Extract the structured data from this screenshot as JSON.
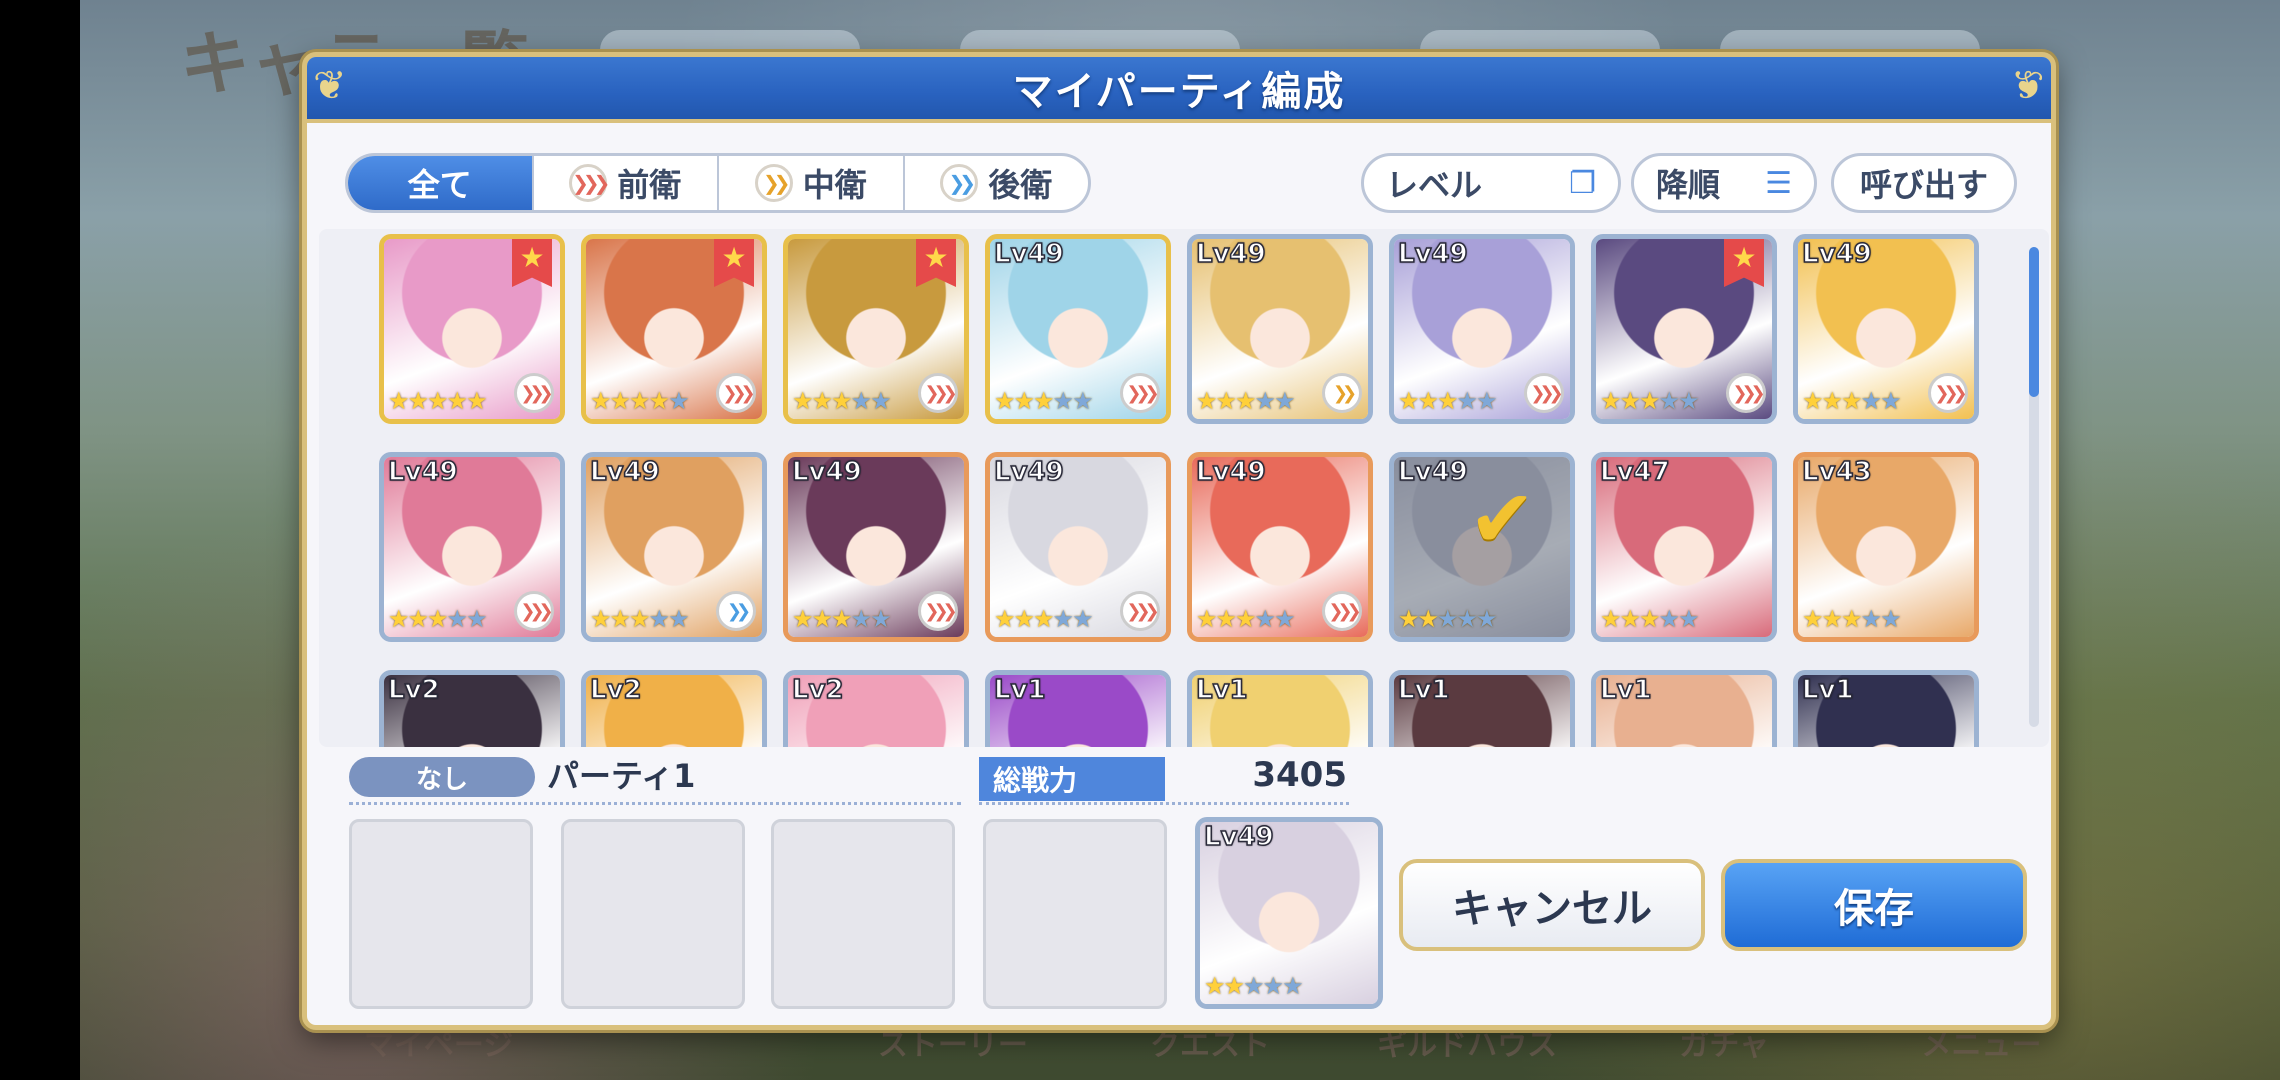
{
  "window": {
    "title": "マイパーティ編成"
  },
  "background": {
    "title": "キャラ一覧",
    "nav": [
      "マイページ",
      "",
      "ストーリー",
      "クエスト",
      "ギルドハウス",
      "ガチャ",
      "メニュー"
    ]
  },
  "filters": {
    "tabs": [
      {
        "label": "全て",
        "active": true
      },
      {
        "label": "前衛",
        "icon": "front-position-icon"
      },
      {
        "label": "中衛",
        "icon": "middle-position-icon"
      },
      {
        "label": "後衛",
        "icon": "back-position-icon"
      }
    ],
    "sort": {
      "label": "レベル",
      "icon": "window-icon"
    },
    "order": {
      "label": "降順",
      "icon": "sort-lines-icon"
    },
    "load": {
      "label": "呼び出す"
    }
  },
  "characters": [
    {
      "level": "",
      "stars": 5,
      "fav": true,
      "role": "front",
      "frame": "gold",
      "color": "#e89ac8"
    },
    {
      "level": "",
      "stars": 4,
      "fav": true,
      "role": "front",
      "frame": "gold",
      "color": "#d9754a"
    },
    {
      "level": "",
      "stars": 3,
      "fav": true,
      "role": "front",
      "frame": "gold",
      "color": "#c89a3e"
    },
    {
      "level": "Lv49",
      "stars": 3,
      "fav": false,
      "role": "front",
      "frame": "gold",
      "color": "#9fd4e8"
    },
    {
      "level": "Lv49",
      "stars": 3,
      "fav": false,
      "role": "middle",
      "frame": "silver",
      "color": "#e6c070"
    },
    {
      "level": "Lv49",
      "stars": 3,
      "fav": false,
      "role": "front",
      "frame": "silver",
      "color": "#a8a0d8"
    },
    {
      "level": "",
      "stars": 3,
      "fav": true,
      "role": "front",
      "frame": "silver",
      "color": "#5a4a80"
    },
    {
      "level": "Lv49",
      "stars": 3,
      "fav": false,
      "role": "front",
      "frame": "silver",
      "color": "#f2c050"
    },
    {
      "level": "Lv49",
      "stars": 3,
      "fav": false,
      "role": "front",
      "frame": "silver",
      "color": "#e07a98"
    },
    {
      "level": "Lv49",
      "stars": 3,
      "fav": false,
      "role": "back",
      "frame": "silver",
      "color": "#e0a060"
    },
    {
      "level": "Lv49",
      "stars": 3,
      "fav": false,
      "role": "front",
      "frame": "copper",
      "color": "#6a3a5a"
    },
    {
      "level": "Lv49",
      "stars": 3,
      "fav": false,
      "role": "front",
      "frame": "copper",
      "color": "#d8d8e0"
    },
    {
      "level": "Lv49",
      "stars": 3,
      "fav": false,
      "role": "front",
      "frame": "copper",
      "color": "#e86a5a"
    },
    {
      "level": "Lv49",
      "stars": 2,
      "fav": false,
      "role": "",
      "frame": "silver",
      "color": "#c8c8d4",
      "selected": true
    },
    {
      "level": "Lv47",
      "stars": 3,
      "fav": false,
      "role": "",
      "frame": "silver",
      "color": "#d86a7a"
    },
    {
      "level": "Lv43",
      "stars": 3,
      "fav": false,
      "role": "",
      "frame": "copper",
      "color": "#e8a868"
    },
    {
      "level": "Lv2",
      "stars": 0,
      "fav": false,
      "role": "",
      "frame": "silver",
      "color": "#3a3040"
    },
    {
      "level": "Lv2",
      "stars": 0,
      "fav": false,
      "role": "",
      "frame": "silver",
      "color": "#f0b048"
    },
    {
      "level": "Lv2",
      "stars": 0,
      "fav": false,
      "role": "",
      "frame": "silver",
      "color": "#f0a0b8"
    },
    {
      "level": "Lv1",
      "stars": 0,
      "fav": false,
      "role": "",
      "frame": "silver",
      "color": "#9a4ac8"
    },
    {
      "level": "Lv1",
      "stars": 0,
      "fav": false,
      "role": "",
      "frame": "silver",
      "color": "#f0d070"
    },
    {
      "level": "Lv1",
      "stars": 0,
      "fav": false,
      "role": "",
      "frame": "silver",
      "color": "#5a3a40"
    },
    {
      "level": "Lv1",
      "stars": 0,
      "fav": false,
      "role": "",
      "frame": "silver",
      "color": "#e8b090"
    },
    {
      "level": "Lv1",
      "stars": 0,
      "fav": false,
      "role": "",
      "frame": "silver",
      "color": "#303050"
    }
  ],
  "party": {
    "tag": "なし",
    "name": "パーティ1",
    "power_label": "総戦力",
    "power_value": "3405",
    "slots": [
      null,
      null,
      null,
      null,
      {
        "level": "Lv49",
        "stars": 2,
        "color": "#d8d0e0"
      }
    ]
  },
  "buttons": {
    "cancel": "キャンセル",
    "save": "保存"
  },
  "colors": {
    "accent": "#2f6bc9",
    "gold_border": "#d9c07c",
    "star": "#ffd03a"
  }
}
